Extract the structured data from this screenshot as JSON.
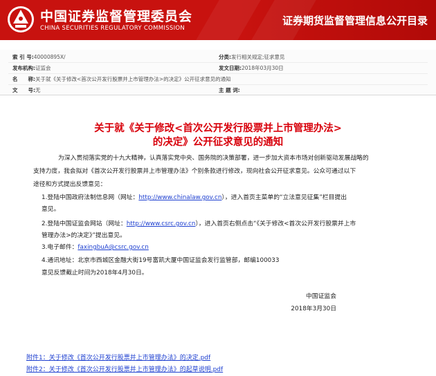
{
  "header": {
    "org_cn": "中国证券监督管理委员会",
    "org_en": "CHINA SECURITIES REGULATORY COMMISSION",
    "catalog_title": "证券期货监督管理信息公开目录",
    "banner_color": "#c8120f"
  },
  "meta": {
    "index_label": "索 引 号:",
    "index_value": "40000895X/",
    "category_label": "分类:",
    "category_value": "发行相关规定;征求意见",
    "publisher_label": "发布机构:",
    "publisher_value": "证监会",
    "date_label": "发文日期:",
    "date_value": "2018年03月30日",
    "name_label": "名　　称:",
    "name_value": "关于就《关于修改<首次公开发行股票并上市管理办法>的决定》公开征求意见的通知",
    "docno_label": "文　　号:",
    "docno_value": "无",
    "subject_label": "主 题 词:",
    "subject_value": ""
  },
  "notice": {
    "title_line1": "关于就《关于修改<首次公开发行股票并上市管理办法>",
    "title_line2": "的决定》公开征求意见的通知",
    "title_color": "#d8000b",
    "intro_line1": "为深入贯彻落实党的十九大精神，认真落实党中央、国务院的决策部署，进一步加大资本市场对创新驱动发展战略的",
    "intro_line2": "支持力度，我会拟对《首次公开发行股票并上市管理办法》个别条款进行修改，现向社会公开征求意见。公众可通过以下",
    "intro_line3": "途径和方式提出反馈意见：",
    "item1_pre": "1.登陆中国政府法制信息网（网址：",
    "item1_link": "http://www.chinalaw.gov.cn",
    "item1_post": "），进入首页主菜单的“立法意见征集”栏目提出",
    "item1_line2": "意见。",
    "item2_pre": "2.登陆中国证监会网站（网址：",
    "item2_link": "http://www.csrc.gov.cn",
    "item2_post": "），进入首页右侧点击“《关于修改<首次公开发行股票并上市",
    "item2_line2": "管理办法>的决定》”提出意见。",
    "item3_pre": "3.电子邮件：",
    "item3_link": "faxingbuA@csrc.gov.cn",
    "item4": "4.通讯地址：北京市西城区金融大街19号富凯大厦中国证监会发行监管部，邮编100033",
    "deadline": "意见反馈截止时间为2018年4月30日。",
    "signature_org": "中国证监会",
    "signature_date": "2018年3月30日",
    "link_color": "#1d3fd0"
  },
  "attachments": [
    "附件1：关于修改《首次公开发行股票并上市管理办法》的决定.pdf",
    "附件2：关于修改《首次公开发行股票并上市管理办法》的起草说明.pdf"
  ]
}
